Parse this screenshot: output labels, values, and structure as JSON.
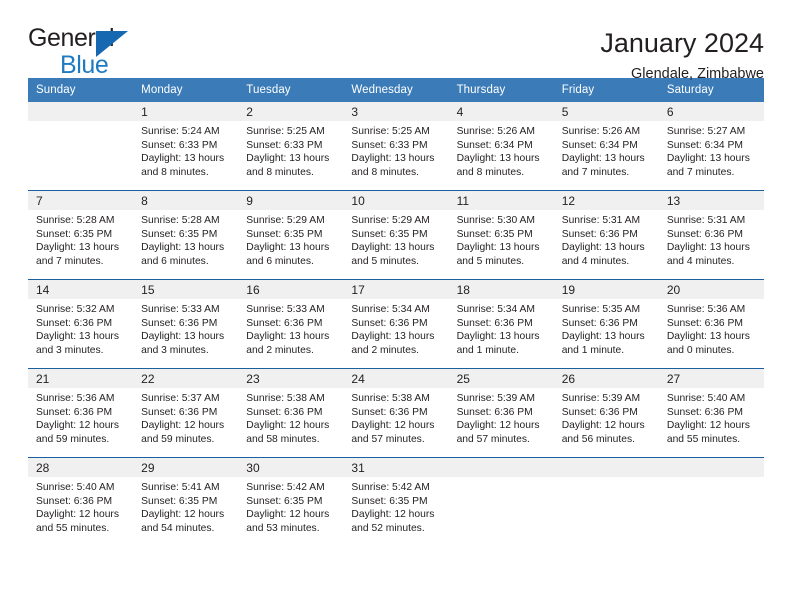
{
  "brand": {
    "name_part1": "General",
    "name_part2": "Blue",
    "triangle_color": "#1668b0",
    "blue_color": "#1f7bc1"
  },
  "header": {
    "title": "January 2024",
    "subtitle": "Glendale, Zimbabwe"
  },
  "theme": {
    "header_bg": "#3b7cb8",
    "row_divider": "#1a5fa0",
    "daynum_bg": "#f0f0f0",
    "text": "#231f20"
  },
  "calendar": {
    "weekday_headers": [
      "Sunday",
      "Monday",
      "Tuesday",
      "Wednesday",
      "Thursday",
      "Friday",
      "Saturday"
    ],
    "labels": {
      "sunrise": "Sunrise:",
      "sunset": "Sunset:",
      "daylight": "Daylight:"
    },
    "weeks": [
      [
        {
          "day": "",
          "sunrise": "",
          "sunset": "",
          "daylight": "",
          "empty": true
        },
        {
          "day": "1",
          "sunrise": "Sunrise: 5:24 AM",
          "sunset": "Sunset: 6:33 PM",
          "daylight": "Daylight: 13 hours and 8 minutes."
        },
        {
          "day": "2",
          "sunrise": "Sunrise: 5:25 AM",
          "sunset": "Sunset: 6:33 PM",
          "daylight": "Daylight: 13 hours and 8 minutes."
        },
        {
          "day": "3",
          "sunrise": "Sunrise: 5:25 AM",
          "sunset": "Sunset: 6:33 PM",
          "daylight": "Daylight: 13 hours and 8 minutes."
        },
        {
          "day": "4",
          "sunrise": "Sunrise: 5:26 AM",
          "sunset": "Sunset: 6:34 PM",
          "daylight": "Daylight: 13 hours and 8 minutes."
        },
        {
          "day": "5",
          "sunrise": "Sunrise: 5:26 AM",
          "sunset": "Sunset: 6:34 PM",
          "daylight": "Daylight: 13 hours and 7 minutes."
        },
        {
          "day": "6",
          "sunrise": "Sunrise: 5:27 AM",
          "sunset": "Sunset: 6:34 PM",
          "daylight": "Daylight: 13 hours and 7 minutes."
        }
      ],
      [
        {
          "day": "7",
          "sunrise": "Sunrise: 5:28 AM",
          "sunset": "Sunset: 6:35 PM",
          "daylight": "Daylight: 13 hours and 7 minutes."
        },
        {
          "day": "8",
          "sunrise": "Sunrise: 5:28 AM",
          "sunset": "Sunset: 6:35 PM",
          "daylight": "Daylight: 13 hours and 6 minutes."
        },
        {
          "day": "9",
          "sunrise": "Sunrise: 5:29 AM",
          "sunset": "Sunset: 6:35 PM",
          "daylight": "Daylight: 13 hours and 6 minutes."
        },
        {
          "day": "10",
          "sunrise": "Sunrise: 5:29 AM",
          "sunset": "Sunset: 6:35 PM",
          "daylight": "Daylight: 13 hours and 5 minutes."
        },
        {
          "day": "11",
          "sunrise": "Sunrise: 5:30 AM",
          "sunset": "Sunset: 6:35 PM",
          "daylight": "Daylight: 13 hours and 5 minutes."
        },
        {
          "day": "12",
          "sunrise": "Sunrise: 5:31 AM",
          "sunset": "Sunset: 6:36 PM",
          "daylight": "Daylight: 13 hours and 4 minutes."
        },
        {
          "day": "13",
          "sunrise": "Sunrise: 5:31 AM",
          "sunset": "Sunset: 6:36 PM",
          "daylight": "Daylight: 13 hours and 4 minutes."
        }
      ],
      [
        {
          "day": "14",
          "sunrise": "Sunrise: 5:32 AM",
          "sunset": "Sunset: 6:36 PM",
          "daylight": "Daylight: 13 hours and 3 minutes."
        },
        {
          "day": "15",
          "sunrise": "Sunrise: 5:33 AM",
          "sunset": "Sunset: 6:36 PM",
          "daylight": "Daylight: 13 hours and 3 minutes."
        },
        {
          "day": "16",
          "sunrise": "Sunrise: 5:33 AM",
          "sunset": "Sunset: 6:36 PM",
          "daylight": "Daylight: 13 hours and 2 minutes."
        },
        {
          "day": "17",
          "sunrise": "Sunrise: 5:34 AM",
          "sunset": "Sunset: 6:36 PM",
          "daylight": "Daylight: 13 hours and 2 minutes."
        },
        {
          "day": "18",
          "sunrise": "Sunrise: 5:34 AM",
          "sunset": "Sunset: 6:36 PM",
          "daylight": "Daylight: 13 hours and 1 minute."
        },
        {
          "day": "19",
          "sunrise": "Sunrise: 5:35 AM",
          "sunset": "Sunset: 6:36 PM",
          "daylight": "Daylight: 13 hours and 1 minute."
        },
        {
          "day": "20",
          "sunrise": "Sunrise: 5:36 AM",
          "sunset": "Sunset: 6:36 PM",
          "daylight": "Daylight: 13 hours and 0 minutes."
        }
      ],
      [
        {
          "day": "21",
          "sunrise": "Sunrise: 5:36 AM",
          "sunset": "Sunset: 6:36 PM",
          "daylight": "Daylight: 12 hours and 59 minutes."
        },
        {
          "day": "22",
          "sunrise": "Sunrise: 5:37 AM",
          "sunset": "Sunset: 6:36 PM",
          "daylight": "Daylight: 12 hours and 59 minutes."
        },
        {
          "day": "23",
          "sunrise": "Sunrise: 5:38 AM",
          "sunset": "Sunset: 6:36 PM",
          "daylight": "Daylight: 12 hours and 58 minutes."
        },
        {
          "day": "24",
          "sunrise": "Sunrise: 5:38 AM",
          "sunset": "Sunset: 6:36 PM",
          "daylight": "Daylight: 12 hours and 57 minutes."
        },
        {
          "day": "25",
          "sunrise": "Sunrise: 5:39 AM",
          "sunset": "Sunset: 6:36 PM",
          "daylight": "Daylight: 12 hours and 57 minutes."
        },
        {
          "day": "26",
          "sunrise": "Sunrise: 5:39 AM",
          "sunset": "Sunset: 6:36 PM",
          "daylight": "Daylight: 12 hours and 56 minutes."
        },
        {
          "day": "27",
          "sunrise": "Sunrise: 5:40 AM",
          "sunset": "Sunset: 6:36 PM",
          "daylight": "Daylight: 12 hours and 55 minutes."
        }
      ],
      [
        {
          "day": "28",
          "sunrise": "Sunrise: 5:40 AM",
          "sunset": "Sunset: 6:36 PM",
          "daylight": "Daylight: 12 hours and 55 minutes."
        },
        {
          "day": "29",
          "sunrise": "Sunrise: 5:41 AM",
          "sunset": "Sunset: 6:35 PM",
          "daylight": "Daylight: 12 hours and 54 minutes."
        },
        {
          "day": "30",
          "sunrise": "Sunrise: 5:42 AM",
          "sunset": "Sunset: 6:35 PM",
          "daylight": "Daylight: 12 hours and 53 minutes."
        },
        {
          "day": "31",
          "sunrise": "Sunrise: 5:42 AM",
          "sunset": "Sunset: 6:35 PM",
          "daylight": "Daylight: 12 hours and 52 minutes."
        },
        {
          "day": "",
          "sunrise": "",
          "sunset": "",
          "daylight": "",
          "empty": true
        },
        {
          "day": "",
          "sunrise": "",
          "sunset": "",
          "daylight": "",
          "empty": true
        },
        {
          "day": "",
          "sunrise": "",
          "sunset": "",
          "daylight": "",
          "empty": true
        }
      ]
    ]
  }
}
